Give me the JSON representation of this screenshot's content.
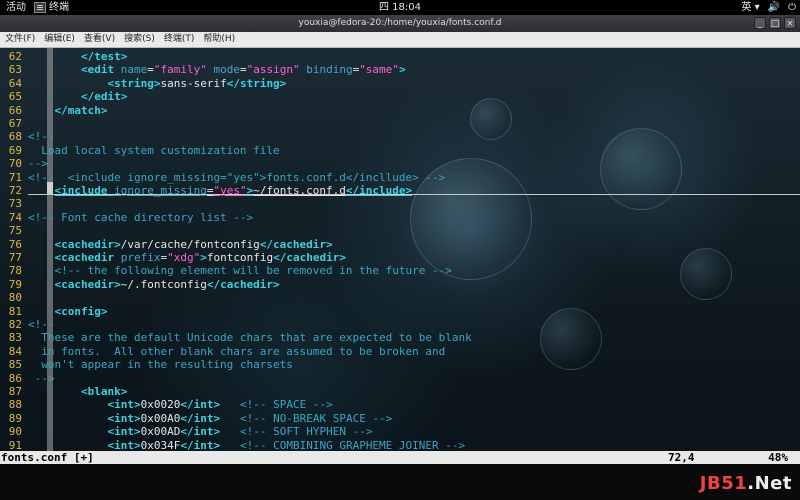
{
  "topbar": {
    "activities": "活动",
    "app_name": "终端",
    "clock": "四 18:04",
    "input_method": "英 ▾",
    "icons": [
      "volume-icon",
      "power-icon"
    ]
  },
  "window": {
    "title": "youxia@fedora-20:/home/youxia/fonts.conf.d",
    "buttons": [
      "_",
      "□",
      "×"
    ]
  },
  "menu": [
    "文件(F)",
    "编辑(E)",
    "查看(V)",
    "搜索(S)",
    "终端(T)",
    "帮助(H)"
  ],
  "editor": {
    "lines": [
      {
        "n": "62",
        "indent": "        ",
        "segs": [
          [
            "tag",
            "</test>"
          ]
        ]
      },
      {
        "n": "63",
        "indent": "        ",
        "segs": [
          [
            "tag",
            "<edit "
          ],
          [
            "attr",
            "name"
          ],
          [
            "txt",
            "="
          ],
          [
            "val",
            "\"family\""
          ],
          [
            "txt",
            " "
          ],
          [
            "attr",
            "mode"
          ],
          [
            "txt",
            "="
          ],
          [
            "val",
            "\"assign\""
          ],
          [
            "txt",
            " "
          ],
          [
            "attr",
            "binding"
          ],
          [
            "txt",
            "="
          ],
          [
            "val",
            "\"same\""
          ],
          [
            "tag",
            ">"
          ]
        ]
      },
      {
        "n": "64",
        "indent": "            ",
        "segs": [
          [
            "tag",
            "<string>"
          ],
          [
            "txt",
            "sans-serif"
          ],
          [
            "tag",
            "</string>"
          ]
        ]
      },
      {
        "n": "65",
        "indent": "        ",
        "segs": [
          [
            "tag",
            "</edit>"
          ]
        ]
      },
      {
        "n": "66",
        "indent": "    ",
        "segs": [
          [
            "tag",
            "</match>"
          ]
        ]
      },
      {
        "n": "67",
        "indent": "",
        "segs": []
      },
      {
        "n": "68",
        "indent": "",
        "segs": [
          [
            "cmt",
            "<!--"
          ]
        ]
      },
      {
        "n": "69",
        "indent": "  ",
        "segs": [
          [
            "cmt",
            "Load local system customization file"
          ]
        ]
      },
      {
        "n": "70",
        "indent": "",
        "segs": [
          [
            "cmt",
            "-->"
          ]
        ]
      },
      {
        "n": "71",
        "indent": "",
        "segs": [
          [
            "cmt",
            "<!--  "
          ],
          [
            "cmt",
            "<include ignore_missing=\"yes\">fonts.conf.d</incllude> -->"
          ]
        ]
      },
      {
        "n": "72",
        "indent": "    ",
        "segs": [
          [
            "tag",
            "<include "
          ],
          [
            "attr",
            "ignore_missing"
          ],
          [
            "txt",
            "="
          ],
          [
            "val",
            "\"yes\""
          ],
          [
            "tag",
            ">"
          ],
          [
            "txt",
            "~/fonts.conf.d"
          ],
          [
            "tag",
            "</include>"
          ]
        ]
      },
      {
        "n": "73",
        "indent": "",
        "segs": []
      },
      {
        "n": "74",
        "indent": "",
        "segs": [
          [
            "cmt",
            "<!-- Font cache directory list -->"
          ]
        ]
      },
      {
        "n": "75",
        "indent": "",
        "segs": []
      },
      {
        "n": "76",
        "indent": "    ",
        "segs": [
          [
            "tag",
            "<cachedir>"
          ],
          [
            "txt",
            "/var/cache/fontconfig"
          ],
          [
            "tag",
            "</cachedir>"
          ]
        ]
      },
      {
        "n": "77",
        "indent": "    ",
        "segs": [
          [
            "tag",
            "<cachedir "
          ],
          [
            "attr",
            "prefix"
          ],
          [
            "txt",
            "="
          ],
          [
            "val",
            "\"xdg\""
          ],
          [
            "tag",
            ">"
          ],
          [
            "txt",
            "fontconfig"
          ],
          [
            "tag",
            "</cachedir>"
          ]
        ]
      },
      {
        "n": "78",
        "indent": "    ",
        "segs": [
          [
            "cmt",
            "<!-- the following element will be removed in the future -->"
          ]
        ]
      },
      {
        "n": "79",
        "indent": "    ",
        "segs": [
          [
            "tag",
            "<cachedir>"
          ],
          [
            "txt",
            "~/.fontconfig"
          ],
          [
            "tag",
            "</cachedir>"
          ]
        ]
      },
      {
        "n": "80",
        "indent": "",
        "segs": []
      },
      {
        "n": "81",
        "indent": "    ",
        "segs": [
          [
            "tag",
            "<config>"
          ]
        ]
      },
      {
        "n": "82",
        "indent": "",
        "segs": [
          [
            "cmt",
            "<!--"
          ]
        ]
      },
      {
        "n": "83",
        "indent": "  ",
        "segs": [
          [
            "cmt",
            "These are the default Unicode chars that are expected to be blank"
          ]
        ]
      },
      {
        "n": "84",
        "indent": "  ",
        "segs": [
          [
            "cmt",
            "in fonts.  All other blank chars are assumed to be broken and"
          ]
        ]
      },
      {
        "n": "85",
        "indent": "  ",
        "segs": [
          [
            "cmt",
            "won't appear in the resulting charsets"
          ]
        ]
      },
      {
        "n": "86",
        "indent": " ",
        "segs": [
          [
            "cmt",
            "-->"
          ]
        ]
      },
      {
        "n": "87",
        "indent": "        ",
        "segs": [
          [
            "tag",
            "<blank>"
          ]
        ]
      },
      {
        "n": "88",
        "indent": "            ",
        "segs": [
          [
            "tag",
            "<int>"
          ],
          [
            "txt",
            "0x0020"
          ],
          [
            "tag",
            "</int>"
          ],
          [
            "txt",
            "   "
          ],
          [
            "cmt",
            "<!-- SPACE -->"
          ]
        ]
      },
      {
        "n": "89",
        "indent": "            ",
        "segs": [
          [
            "tag",
            "<int>"
          ],
          [
            "txt",
            "0x00A0"
          ],
          [
            "tag",
            "</int>"
          ],
          [
            "txt",
            "   "
          ],
          [
            "cmt",
            "<!-- NO-BREAK SPACE -->"
          ]
        ]
      },
      {
        "n": "90",
        "indent": "            ",
        "segs": [
          [
            "tag",
            "<int>"
          ],
          [
            "txt",
            "0x00AD"
          ],
          [
            "tag",
            "</int>"
          ],
          [
            "txt",
            "   "
          ],
          [
            "cmt",
            "<!-- SOFT HYPHEN -->"
          ]
        ]
      },
      {
        "n": "91",
        "indent": "            ",
        "segs": [
          [
            "tag",
            "<int>"
          ],
          [
            "txt",
            "0x034F"
          ],
          [
            "tag",
            "</int>"
          ],
          [
            "txt",
            "   "
          ],
          [
            "cmt",
            "<!-- COMBINING GRAPHEME JOINER -->"
          ]
        ]
      }
    ]
  },
  "status": {
    "filename": "fonts.conf [+]",
    "position": "72,4",
    "percent": "48%"
  },
  "watermark": {
    "brand": "JB51",
    "dot": ".",
    "tld": "Net"
  }
}
